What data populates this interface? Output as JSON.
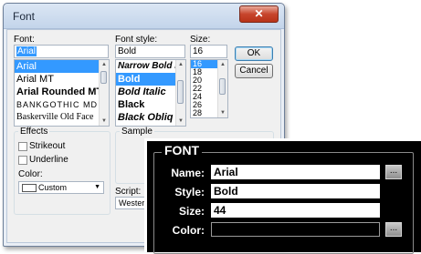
{
  "dialog": {
    "title": "Font",
    "close_glyph": "✕",
    "font_label": "Font:",
    "style_label": "Font style:",
    "size_label": "Size:",
    "font_value": "Arial",
    "style_value": "Bold",
    "size_value": "16",
    "font_list": [
      "Arial",
      "Arial MT",
      "Arial Rounded MT",
      "BANKGOTHIC MD",
      "Baskerville Old Face"
    ],
    "style_list": [
      "Narrow Bold Itali",
      "Bold",
      "Bold Italic",
      "Black",
      "Black Obliq"
    ],
    "size_list": [
      "16",
      "18",
      "20",
      "22",
      "24",
      "26",
      "28"
    ],
    "ok_label": "OK",
    "cancel_label": "Cancel",
    "effects_label": "Effects",
    "strikeout_label": "Strikeout",
    "underline_label": "Underline",
    "color_label": "Color:",
    "color_value": "Custom",
    "sample_label": "Sample",
    "script_label": "Script:",
    "script_value": "Western",
    "scroll_up": "▲",
    "scroll_down": "▼",
    "dropdown_glyph": "▼"
  },
  "panel": {
    "title": "FONT",
    "name_label": "Name:",
    "name_value": "Arial",
    "style_label": "Style:",
    "style_value": "Bold",
    "size_label": "Size:",
    "size_value": "44",
    "color_label": "Color:",
    "color_value": "",
    "browse_label": "...",
    "colors": {
      "background": "#000000",
      "field": "#ffffff",
      "text": "#ffffff"
    }
  }
}
